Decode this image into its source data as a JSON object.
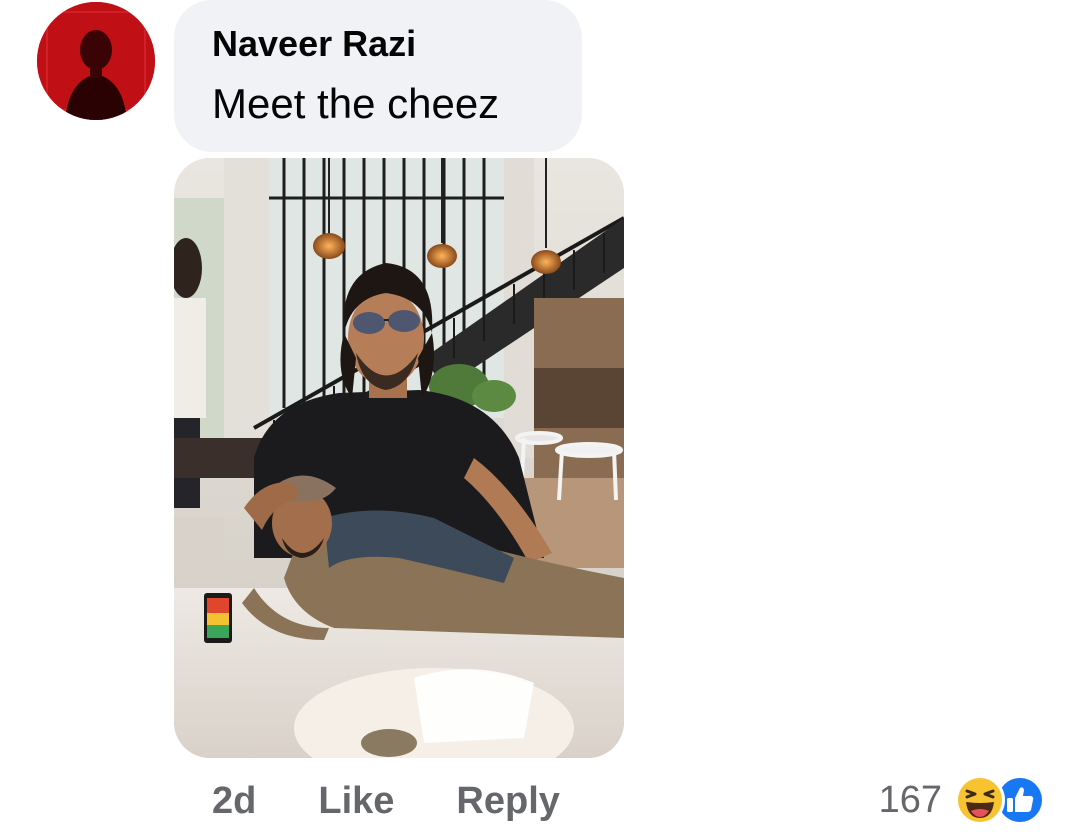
{
  "comment": {
    "author": "Naveer Razi",
    "text": "Meet the cheez",
    "timestamp": "2d",
    "like_label": "Like",
    "reply_label": "Reply",
    "reaction_count": "167",
    "reaction_icons": [
      "haha-icon",
      "like-icon"
    ]
  },
  "colors": {
    "bubble_bg": "#f0f2f5",
    "muted_text": "#65676b",
    "like_blue": "#1877f2",
    "haha_yellow": "#f7c331",
    "avatar_red": "#c8101a"
  }
}
